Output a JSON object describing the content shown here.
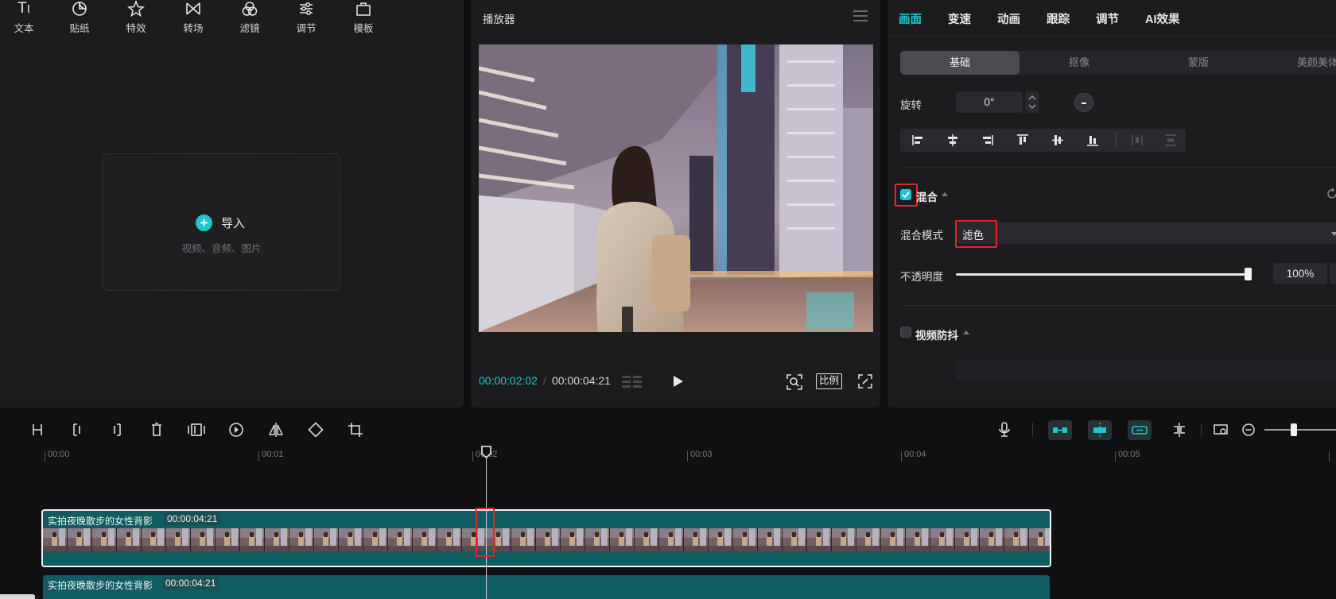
{
  "toolbar": {
    "items": [
      {
        "label": "文本",
        "icon": "text-icon"
      },
      {
        "label": "贴纸",
        "icon": "sticker-icon"
      },
      {
        "label": "特效",
        "icon": "effects-icon"
      },
      {
        "label": "转场",
        "icon": "transition-icon"
      },
      {
        "label": "滤镜",
        "icon": "filter-icon"
      },
      {
        "label": "调节",
        "icon": "adjust-icon"
      },
      {
        "label": "模板",
        "icon": "template-icon"
      }
    ]
  },
  "media": {
    "import_label": "导入",
    "import_hint": "视频、音频、图片"
  },
  "player": {
    "title": "播放器",
    "current_time": "00:00:02:02",
    "separator": "/",
    "total_time": "00:00:04:21",
    "ratio_label": "比例"
  },
  "inspector": {
    "tabs": [
      "画面",
      "变速",
      "动画",
      "跟踪",
      "调节",
      "AI效果"
    ],
    "active_tab": "画面",
    "subtabs": [
      "基础",
      "抠像",
      "蒙版",
      "美颜美体"
    ],
    "active_subtab": "基础",
    "rotate_label": "旋转",
    "rotate_value": "0°",
    "blend": {
      "title": "混合",
      "checked": true,
      "mode_label": "混合模式",
      "mode_value": "滤色",
      "opacity_label": "不透明度",
      "opacity_value": "100%",
      "opacity_level": 1.0
    },
    "stabilize": {
      "title": "视频防抖",
      "checked": false
    }
  },
  "timeline": {
    "ruler_labels": [
      "00:00",
      "00:01",
      "00:02",
      "00:03",
      "00:04",
      "00:05"
    ],
    "clips": [
      {
        "name": "实拍夜晚散步的女性背影",
        "duration": "00:00:04:21"
      },
      {
        "name": "实拍夜晚散步的女性背影",
        "duration": "00:00:04:21"
      }
    ]
  },
  "colors": {
    "accent": "#1fc6d1",
    "highlight_box": "#e0272a",
    "clip_teal": "#0f5c61"
  }
}
